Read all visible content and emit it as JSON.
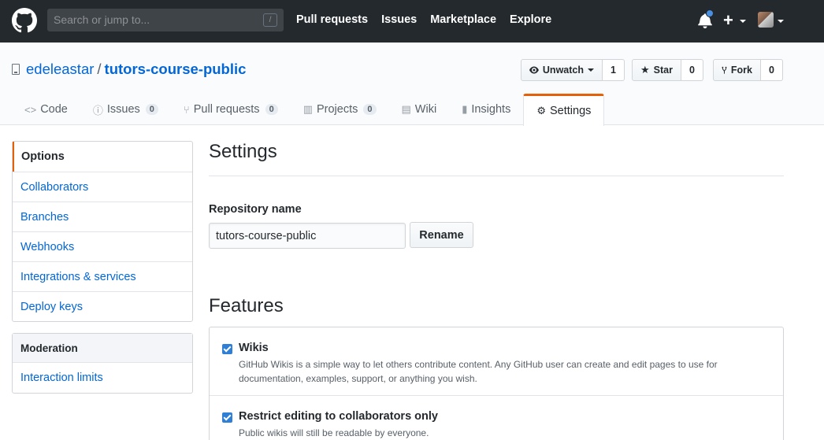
{
  "header": {
    "search_placeholder": "Search or jump to...",
    "search_shortcut": "/",
    "nav": [
      "Pull requests",
      "Issues",
      "Marketplace",
      "Explore"
    ],
    "plus": "+"
  },
  "repo": {
    "owner": "edeleastar",
    "separator": "/",
    "name": "tutors-course-public",
    "watch_label": "Unwatch",
    "watch_count": "1",
    "star_label": "Star",
    "star_count": "0",
    "fork_label": "Fork",
    "fork_count": "0"
  },
  "tabs": [
    {
      "label": "Code",
      "icon": "code-icon"
    },
    {
      "label": "Issues",
      "count": "0",
      "icon": "issue-icon"
    },
    {
      "label": "Pull requests",
      "count": "0",
      "icon": "pull-request-icon"
    },
    {
      "label": "Projects",
      "count": "0",
      "icon": "project-icon"
    },
    {
      "label": "Wiki",
      "icon": "book-icon"
    },
    {
      "label": "Insights",
      "icon": "graph-icon"
    },
    {
      "label": "Settings",
      "icon": "gear-icon",
      "selected": true
    }
  ],
  "sidebar": {
    "items": [
      "Options",
      "Collaborators",
      "Branches",
      "Webhooks",
      "Integrations & services",
      "Deploy keys"
    ],
    "moderation_heading": "Moderation",
    "moderation_items": [
      "Interaction limits"
    ]
  },
  "main": {
    "title": "Settings",
    "repo_name_label": "Repository name",
    "repo_name_value": "tutors-course-public",
    "rename_button": "Rename",
    "features_title": "Features",
    "features": [
      {
        "title": "Wikis",
        "checked": true,
        "note": "GitHub Wikis is a simple way to let others contribute content. Any GitHub user can create and edit pages to use for documentation, examples, support, or anything you wish."
      },
      {
        "title": "Restrict editing to collaborators only",
        "checked": true,
        "note": "Public wikis will still be readable by everyone."
      }
    ]
  },
  "colors": {
    "header_bg": "#24292e",
    "link": "#0366d6",
    "accent_orange": "#e36209",
    "checkbox_blue": "#2f7fd6",
    "notification_dot": "#4a90e2"
  }
}
